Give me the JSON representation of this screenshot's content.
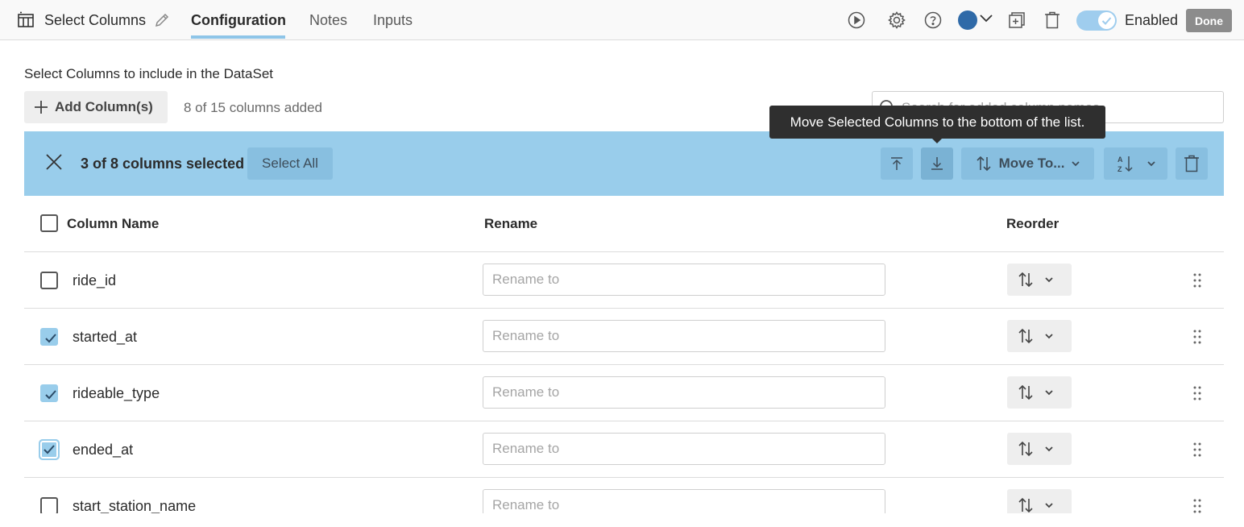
{
  "header": {
    "title": "Select Columns",
    "tabs": [
      {
        "label": "Configuration",
        "active": true
      },
      {
        "label": "Notes",
        "active": false
      },
      {
        "label": "Inputs",
        "active": false
      }
    ],
    "enabled_label": "Enabled",
    "enabled": true,
    "done_label": "Done",
    "avatar_color": "#2f6aa8"
  },
  "subtitle": "Select Columns to include in the DataSet",
  "add_button_label": "Add Column(s)",
  "count_text": "8 of 15 columns added",
  "search": {
    "placeholder": "Search for added column names"
  },
  "selection_bar": {
    "count_text": "3 of 8 columns selected",
    "select_all_label": "Select All",
    "move_to_label": "Move To...",
    "color": "#99cdeb"
  },
  "tooltip": "Move Selected Columns to the bottom of the list.",
  "table": {
    "headers": {
      "column_name": "Column Name",
      "rename": "Rename",
      "reorder": "Reorder"
    },
    "rows": [
      {
        "name": "ride_id",
        "checked": false,
        "rename_placeholder": "Rename to"
      },
      {
        "name": "started_at",
        "checked": true,
        "rename_placeholder": "Rename to"
      },
      {
        "name": "rideable_type",
        "checked": true,
        "rename_placeholder": "Rename to"
      },
      {
        "name": "ended_at",
        "checked": true,
        "rename_placeholder": "Rename to"
      },
      {
        "name": "start_station_name",
        "checked": false,
        "rename_placeholder": "Rename to"
      }
    ]
  }
}
